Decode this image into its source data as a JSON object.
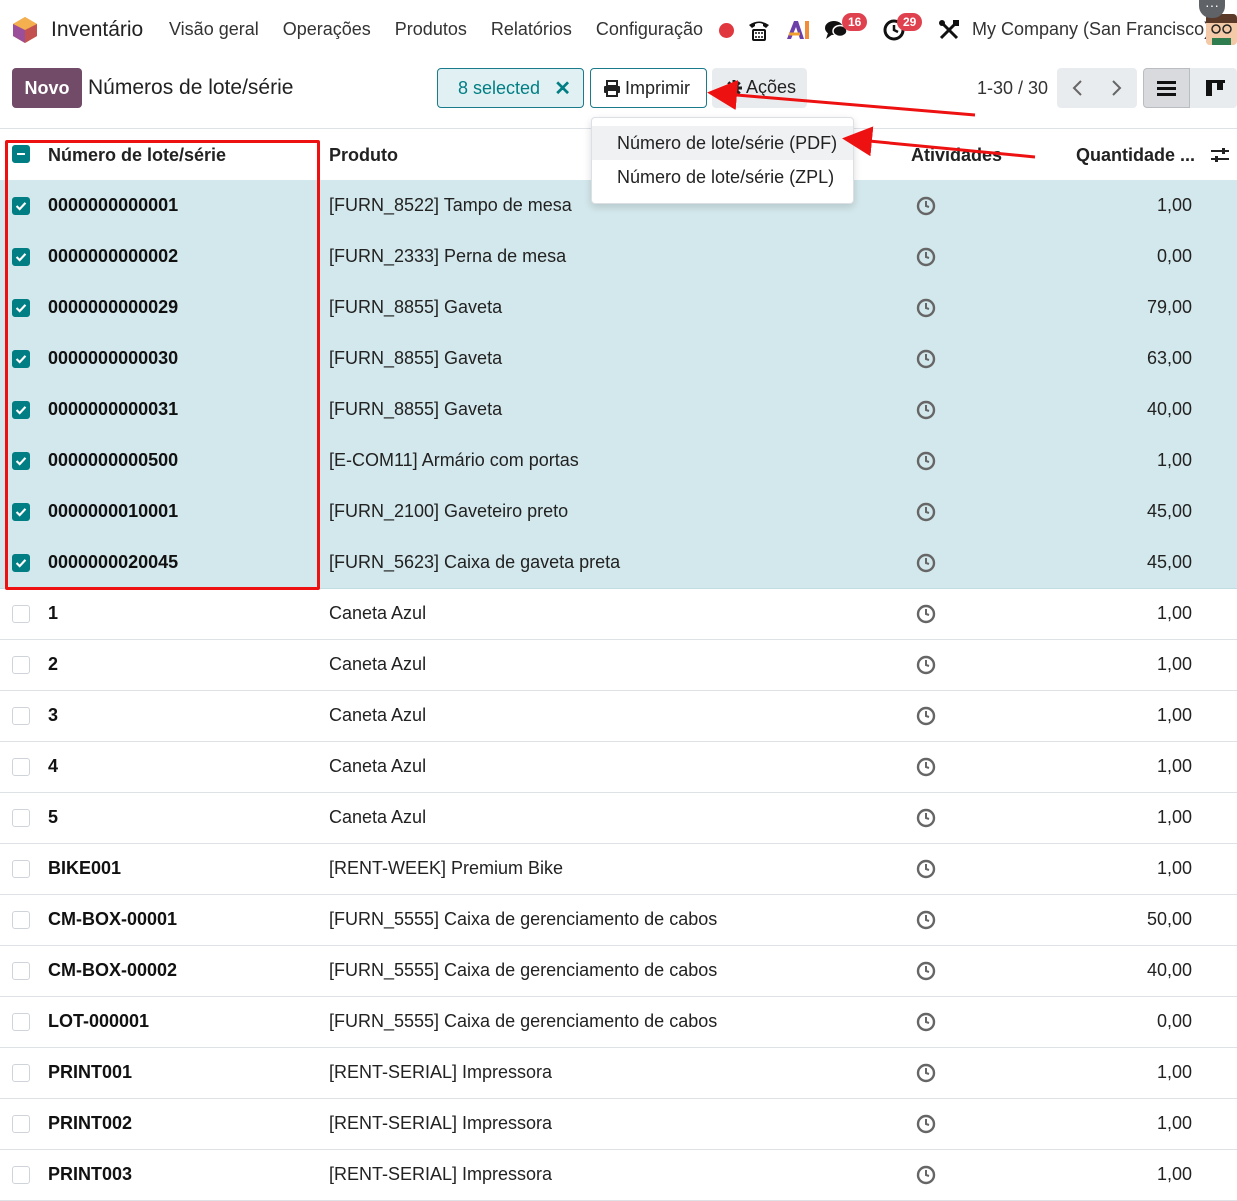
{
  "topbar": {
    "app_name": "Inventário",
    "menu": [
      "Visão geral",
      "Operações",
      "Produtos",
      "Relatórios",
      "Configuração"
    ],
    "messages_badge": "16",
    "activities_badge": "29",
    "company": "My Company (San Francisco)"
  },
  "control": {
    "new_label": "Novo",
    "title": "Números de lote/série",
    "selected_label": "8 selected",
    "clear_icon": "✕",
    "print_label": "Imprimir",
    "actions_label": "Ações",
    "pager": "1-30 / 30"
  },
  "print_menu": [
    "Número de lote/série (PDF)",
    "Número de lote/série (ZPL)"
  ],
  "table": {
    "headers": {
      "lot": "Número de lote/série",
      "product": "Produto",
      "activities": "Atividades",
      "quantity": "Quantidade ..."
    },
    "rows": [
      {
        "lot": "0000000000001",
        "product": "[FURN_8522] Tampo de mesa",
        "qty": "1,00",
        "selected": true
      },
      {
        "lot": "0000000000002",
        "product": "[FURN_2333] Perna de mesa",
        "qty": "0,00",
        "selected": true
      },
      {
        "lot": "0000000000029",
        "product": "[FURN_8855] Gaveta",
        "qty": "79,00",
        "selected": true
      },
      {
        "lot": "0000000000030",
        "product": "[FURN_8855] Gaveta",
        "qty": "63,00",
        "selected": true
      },
      {
        "lot": "0000000000031",
        "product": "[FURN_8855] Gaveta",
        "qty": "40,00",
        "selected": true
      },
      {
        "lot": "0000000000500",
        "product": "[E-COM11] Armário com portas",
        "qty": "1,00",
        "selected": true
      },
      {
        "lot": "0000000010001",
        "product": "[FURN_2100] Gaveteiro preto",
        "qty": "45,00",
        "selected": true
      },
      {
        "lot": "0000000020045",
        "product": "[FURN_5623] Caixa de gaveta preta",
        "qty": "45,00",
        "selected": true
      },
      {
        "lot": "1",
        "product": "Caneta Azul",
        "qty": "1,00",
        "selected": false
      },
      {
        "lot": "2",
        "product": "Caneta Azul",
        "qty": "1,00",
        "selected": false
      },
      {
        "lot": "3",
        "product": "Caneta Azul",
        "qty": "1,00",
        "selected": false
      },
      {
        "lot": "4",
        "product": "Caneta Azul",
        "qty": "1,00",
        "selected": false
      },
      {
        "lot": "5",
        "product": "Caneta Azul",
        "qty": "1,00",
        "selected": false
      },
      {
        "lot": "BIKE001",
        "product": "[RENT-WEEK] Premium Bike",
        "qty": "1,00",
        "selected": false
      },
      {
        "lot": "CM-BOX-00001",
        "product": "[FURN_5555] Caixa de gerenciamento de cabos",
        "qty": "50,00",
        "selected": false
      },
      {
        "lot": "CM-BOX-00002",
        "product": "[FURN_5555] Caixa de gerenciamento de cabos",
        "qty": "40,00",
        "selected": false
      },
      {
        "lot": "LOT-000001",
        "product": "[FURN_5555] Caixa de gerenciamento de cabos",
        "qty": "0,00",
        "selected": false
      },
      {
        "lot": "PRINT001",
        "product": "[RENT-SERIAL] Impressora",
        "qty": "1,00",
        "selected": false
      },
      {
        "lot": "PRINT002",
        "product": "[RENT-SERIAL] Impressora",
        "qty": "1,00",
        "selected": false
      },
      {
        "lot": "PRINT003",
        "product": "[RENT-SERIAL] Impressora",
        "qty": "1,00",
        "selected": false
      }
    ]
  },
  "colors": {
    "brand": "#714b67",
    "accent": "#017e84",
    "selected_row": "#d3e8ec",
    "annotation": "#ee1111"
  }
}
